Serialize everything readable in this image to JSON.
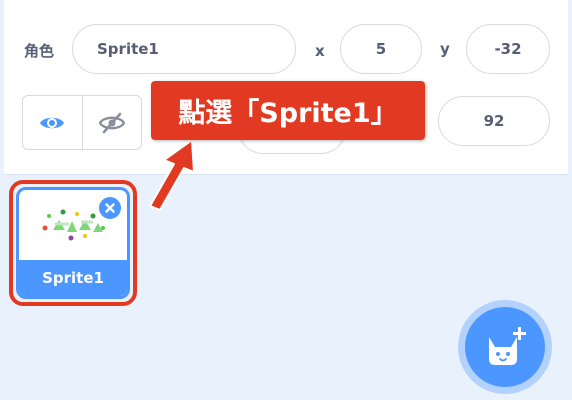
{
  "sprite_info": {
    "sprite_label": "角色",
    "sprite_name_value": "Sprite1",
    "x_label": "x",
    "x_value": "5",
    "y_label": "y",
    "y_value": "-32",
    "direction_value": "92",
    "show_icon": "eye-icon",
    "hide_icon": "eye-slash-icon"
  },
  "sprite_list": {
    "sprites": [
      {
        "name": "Sprite1",
        "selected": true,
        "thumbnail": "green-sparkle-sprite"
      }
    ],
    "delete_icon": "close-icon"
  },
  "annotation": {
    "callout_text": "點選「Sprite1」",
    "arrow_icon": "arrow-up-right-icon"
  },
  "add_sprite": {
    "icon": "cat-plus-icon"
  },
  "colors": {
    "accent": "#4c97ff",
    "callout": "#e23a22",
    "text": "#575e75",
    "background": "#e9f1fc"
  }
}
